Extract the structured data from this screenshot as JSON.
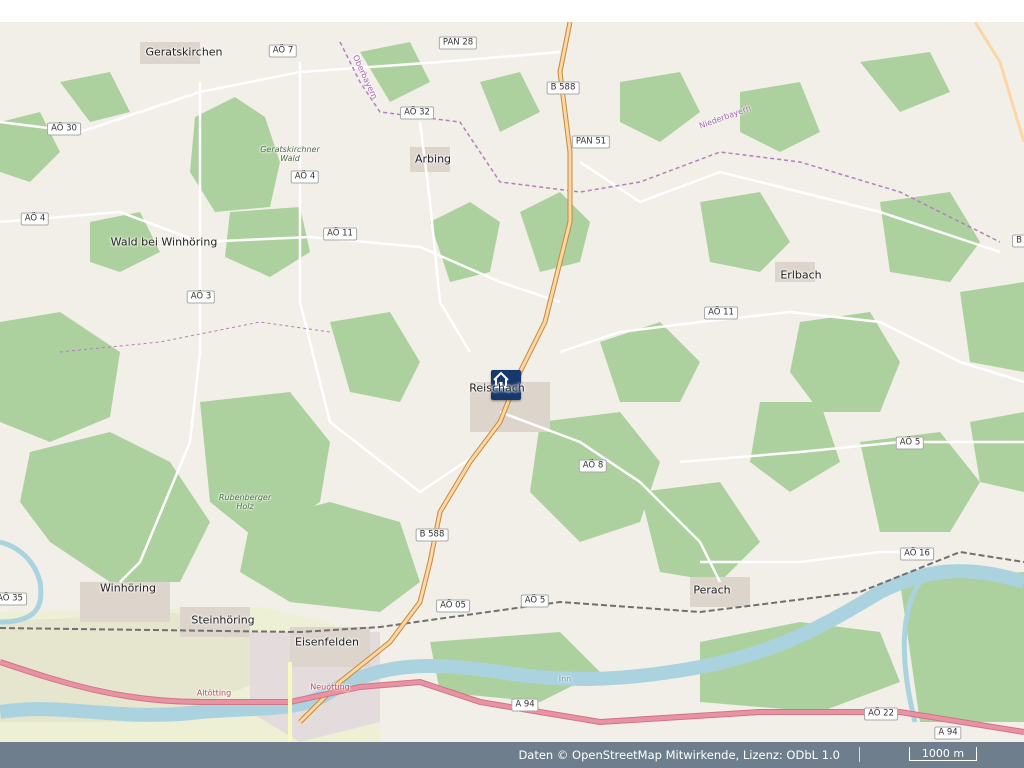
{
  "map": {
    "marker": {
      "icon": "house-icon",
      "label": "Reischach"
    },
    "places": [
      {
        "name": "Geratskirchen",
        "kind": "town"
      },
      {
        "name": "Arbing",
        "kind": "town"
      },
      {
        "name": "Wald bei Winhöring",
        "kind": "town"
      },
      {
        "name": "Erlbach",
        "kind": "town"
      },
      {
        "name": "Winhöring",
        "kind": "town"
      },
      {
        "name": "Steinhöring",
        "kind": "town"
      },
      {
        "name": "Eisenfelden",
        "kind": "town"
      },
      {
        "name": "Perach",
        "kind": "town"
      },
      {
        "name": "Geratskirchner Wald",
        "kind": "wood"
      },
      {
        "name": "Rubenberger Holz",
        "kind": "wood"
      },
      {
        "name": "Niederbayern",
        "kind": "region"
      },
      {
        "name": "Oberbayern",
        "kind": "region"
      },
      {
        "name": "Neuötting",
        "kind": "small"
      },
      {
        "name": "Altötting",
        "kind": "small"
      },
      {
        "name": "Inn",
        "kind": "river"
      }
    ],
    "roads": [
      "AÖ 7",
      "PAN 28",
      "B 588",
      "AÖ 32",
      "PAN 51",
      "AÖ 30",
      "AÖ 4",
      "AÖ 4",
      "AÖ 11",
      "AÖ 11",
      "AÖ 3",
      "AÖ 5",
      "AÖ 8",
      "B 588",
      "AÖ 16",
      "AÖ 35",
      "AÖ 05",
      "AÖ 5",
      "A 94",
      "AÖ 22",
      "A 94",
      "B"
    ]
  },
  "footer": {
    "attribution": "Daten © OpenStreetMap Mitwirkende, Lizenz: ODbL 1.0",
    "scale": "1000 m"
  },
  "colors": {
    "marker": "#16386c",
    "forest": "#add19e",
    "river": "#aad3df",
    "motorway": "#e892a2",
    "primary": "#fcd6a4",
    "footer": "#6f7e8c"
  }
}
